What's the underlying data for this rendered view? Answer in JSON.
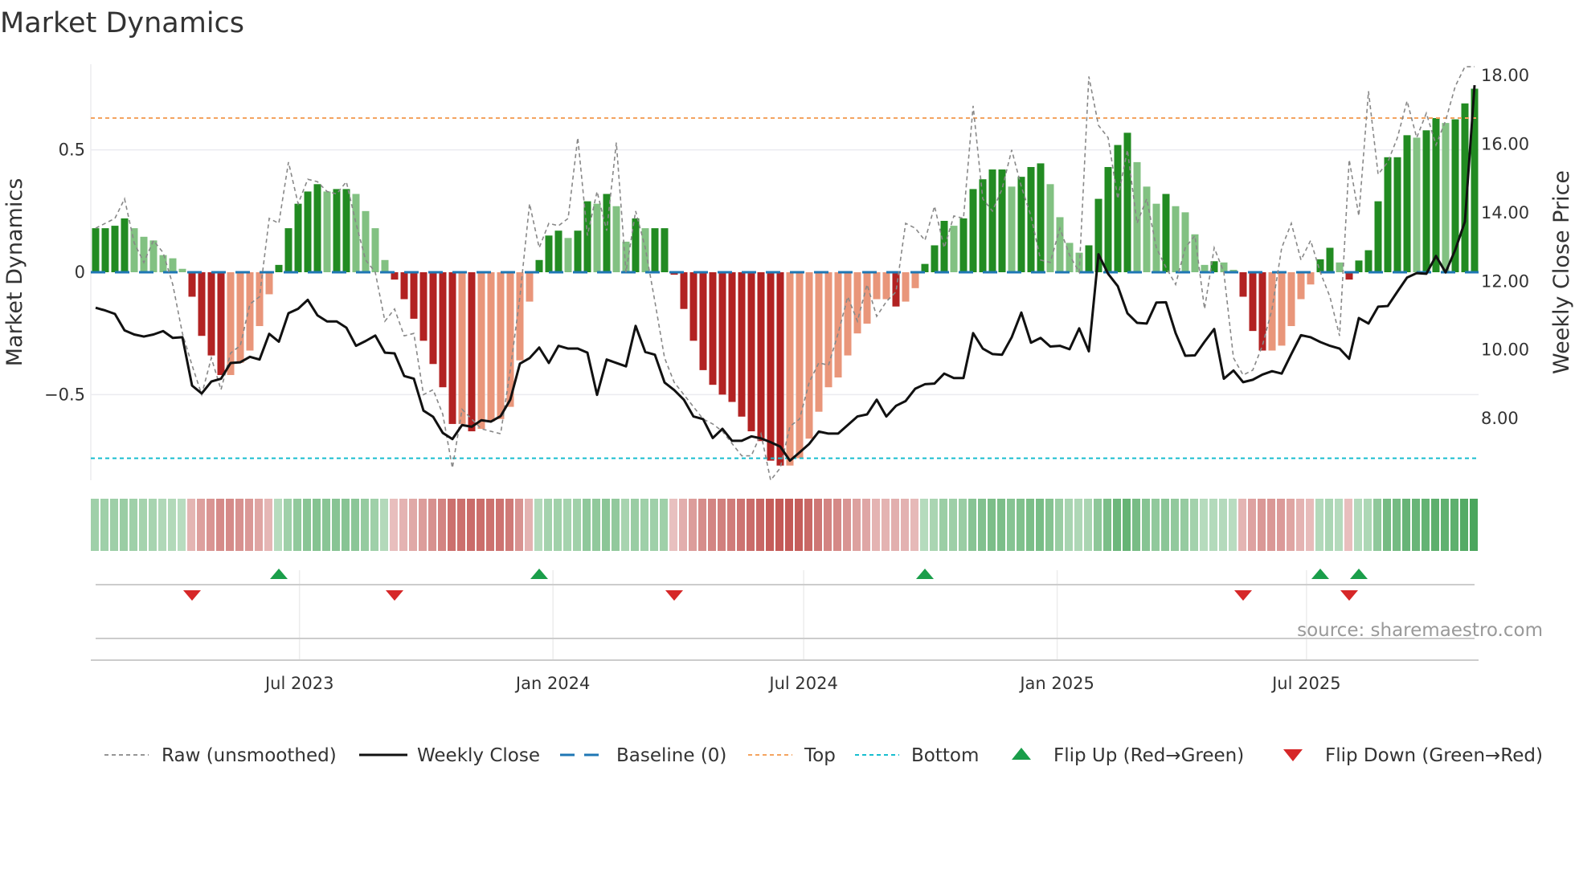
{
  "chart_data": {
    "type": "bar",
    "title": "Market Dynamics",
    "ylabel_left": "Market Dynamics",
    "ylabel_right": "Weekly Close Price",
    "ylim_left": [
      -0.85,
      0.85
    ],
    "ylim_right": [
      6.2,
      18.33
    ],
    "left_ticks": [
      {
        "v": 0.5,
        "label": "0.5"
      },
      {
        "v": 0,
        "label": "0"
      },
      {
        "v": -0.5,
        "label": "−0.5"
      }
    ],
    "right_ticks": [
      {
        "v": 18,
        "label": "18.00"
      },
      {
        "v": 16,
        "label": "16.00"
      },
      {
        "v": 14,
        "label": "14.00"
      },
      {
        "v": 12,
        "label": "12.00"
      },
      {
        "v": 10,
        "label": "10.00"
      },
      {
        "v": 8,
        "label": "8.00"
      }
    ],
    "x_start_date": "2023-02-03",
    "x_frequency": "weekly",
    "x_ticks": [
      {
        "date": "2023-07-01",
        "label": "Jul 2023"
      },
      {
        "date": "2024-01-01",
        "label": "Jan 2024"
      },
      {
        "date": "2024-07-01",
        "label": "Jul 2024"
      },
      {
        "date": "2025-01-01",
        "label": "Jan 2025"
      },
      {
        "date": "2025-07-01",
        "label": "Jul 2025"
      }
    ],
    "top_level": 0.63,
    "bottom_level": -0.76,
    "baseline": 0,
    "series": [
      {
        "name": "Market Dynamics (smoothed)",
        "type": "bar",
        "values": [
          0.18,
          0.18,
          0.19,
          0.22,
          0.18,
          0.145,
          0.13,
          0.07,
          0.057,
          0.014,
          -0.1,
          -0.26,
          -0.34,
          -0.42,
          -0.42,
          -0.37,
          -0.32,
          -0.22,
          -0.09,
          0.03,
          0.18,
          0.28,
          0.33,
          0.36,
          0.33,
          0.34,
          0.34,
          0.32,
          0.25,
          0.18,
          0.05,
          -0.03,
          -0.11,
          -0.19,
          -0.28,
          -0.375,
          -0.47,
          -0.62,
          -0.62,
          -0.65,
          -0.64,
          -0.61,
          -0.6,
          -0.55,
          -0.36,
          -0.12,
          0.05,
          0.15,
          0.17,
          0.14,
          0.17,
          0.29,
          0.28,
          0.32,
          0.27,
          0.125,
          0.22,
          0.18,
          0.18,
          0.18,
          -0.01,
          -0.15,
          -0.28,
          -0.4,
          -0.46,
          -0.5,
          -0.53,
          -0.59,
          -0.65,
          -0.69,
          -0.77,
          -0.79,
          -0.79,
          -0.76,
          -0.68,
          -0.57,
          -0.47,
          -0.43,
          -0.34,
          -0.25,
          -0.21,
          -0.11,
          -0.11,
          -0.14,
          -0.12,
          -0.065,
          0.034,
          0.11,
          0.21,
          0.19,
          0.22,
          0.34,
          0.38,
          0.42,
          0.42,
          0.35,
          0.39,
          0.43,
          0.445,
          0.36,
          0.225,
          0.12,
          0.08,
          0.11,
          0.3,
          0.43,
          0.52,
          0.57,
          0.45,
          0.35,
          0.28,
          0.32,
          0.27,
          0.245,
          0.155,
          0.03,
          0.045,
          0.04,
          0.01,
          -0.1,
          -0.24,
          -0.32,
          -0.32,
          -0.3,
          -0.22,
          -0.11,
          -0.05,
          0.053,
          0.1,
          0.04,
          -0.03,
          0.048,
          0.09,
          0.29,
          0.47,
          0.47,
          0.56,
          0.55,
          0.58,
          0.63,
          0.61,
          0.625,
          0.69,
          0.75
        ]
      },
      {
        "name": "Raw (unsmoothed)",
        "type": "line",
        "values": [
          0.18,
          0.2,
          0.22,
          0.3,
          0.12,
          0.04,
          0.13,
          0.08,
          -0.05,
          -0.25,
          -0.38,
          -0.5,
          -0.35,
          -0.48,
          -0.33,
          -0.3,
          -0.13,
          -0.1,
          0.22,
          0.2,
          0.45,
          0.28,
          0.38,
          0.37,
          0.33,
          0.32,
          0.37,
          0.2,
          0.05,
          0.0,
          -0.2,
          -0.15,
          -0.26,
          -0.25,
          -0.5,
          -0.48,
          -0.58,
          -0.8,
          -0.56,
          -0.6,
          -0.64,
          -0.65,
          -0.66,
          -0.4,
          -0.1,
          0.28,
          0.1,
          0.2,
          0.19,
          0.22,
          0.55,
          0.15,
          0.33,
          0.17,
          0.53,
          0.0,
          0.25,
          0.1,
          -0.12,
          -0.35,
          -0.45,
          -0.5,
          -0.55,
          -0.6,
          -0.62,
          -0.65,
          -0.7,
          -0.75,
          -0.75,
          -0.66,
          -0.85,
          -0.8,
          -0.63,
          -0.6,
          -0.45,
          -0.37,
          -0.38,
          -0.25,
          -0.1,
          -0.2,
          -0.05,
          -0.18,
          -0.12,
          -0.08,
          0.2,
          0.18,
          0.13,
          0.27,
          0.1,
          0.23,
          0.22,
          0.68,
          0.3,
          0.25,
          0.34,
          0.5,
          0.35,
          0.23,
          0.05,
          0.04,
          0.18,
          0.07,
          0.0,
          0.8,
          0.6,
          0.55,
          0.3,
          0.5,
          0.2,
          0.3,
          0.1,
          0.02,
          -0.05,
          0.1,
          0.15,
          -0.15,
          0.1,
          0.0,
          -0.35,
          -0.42,
          -0.4,
          -0.3,
          -0.15,
          0.1,
          0.2,
          0.05,
          0.13,
          0.0,
          -0.1,
          -0.26,
          0.46,
          0.23,
          0.74,
          0.4,
          0.45,
          0.55,
          0.7,
          0.55,
          0.65,
          0.52,
          0.62,
          0.76,
          0.84,
          0.84
        ]
      },
      {
        "name": "Weekly Close",
        "type": "line",
        "axis": "right",
        "values": [
          11.23,
          11.15,
          11.05,
          10.57,
          10.45,
          10.39,
          10.45,
          10.55,
          10.35,
          10.37,
          8.96,
          8.73,
          9.08,
          9.16,
          9.62,
          9.64,
          9.8,
          9.72,
          10.47,
          10.24,
          11.07,
          11.2,
          11.46,
          11.01,
          10.83,
          10.83,
          10.65,
          10.12,
          10.26,
          10.42,
          9.92,
          9.9,
          9.24,
          9.16,
          8.23,
          8.05,
          7.58,
          7.4,
          7.81,
          7.76,
          7.95,
          7.91,
          8.07,
          8.55,
          9.6,
          9.76,
          10.07,
          9.62,
          10.12,
          10.04,
          10.04,
          9.92,
          8.69,
          9.72,
          9.62,
          9.52,
          10.7,
          9.94,
          9.86,
          9.05,
          8.83,
          8.55,
          8.06,
          7.98,
          7.43,
          7.7,
          7.35,
          7.35,
          7.48,
          7.42,
          7.31,
          7.18,
          6.77,
          7.01,
          7.26,
          7.62,
          7.56,
          7.56,
          7.81,
          8.06,
          8.12,
          8.55,
          8.06,
          8.37,
          8.51,
          8.87,
          9.0,
          9.02,
          9.31,
          9.18,
          9.18,
          10.49,
          10.04,
          9.88,
          9.86,
          10.37,
          11.09,
          10.21,
          10.35,
          10.1,
          10.12,
          10.02,
          10.63,
          9.96,
          12.79,
          12.22,
          11.86,
          11.07,
          10.79,
          10.77,
          11.38,
          11.39,
          10.49,
          9.83,
          9.84,
          10.24,
          10.61,
          9.16,
          9.4,
          9.06,
          9.13,
          9.28,
          9.38,
          9.31,
          9.88,
          10.43,
          10.37,
          10.23,
          10.12,
          10.04,
          9.74,
          10.93,
          10.77,
          11.26,
          11.28,
          11.7,
          12.11,
          12.24,
          12.22,
          12.74,
          12.26,
          12.92,
          13.74,
          17.72
        ]
      }
    ],
    "flip_up_weeks": [
      19,
      46,
      86,
      127,
      131
    ],
    "flip_down_weeks": [
      10,
      31,
      60,
      119,
      130
    ],
    "colors": {
      "pos_rising": "#228b22",
      "pos_falling": "#82c182",
      "neg_falling": "#b22222",
      "neg_rising": "#e9967a",
      "close": "#111111",
      "raw": "#888888",
      "baseline": "#1f77b4",
      "top": "#f4a460",
      "bottom": "#17becf",
      "flip_up": "#1a9e4a",
      "flip_down": "#d62728",
      "heat_pos": "#3a9e4e",
      "heat_neg": "#c0504d"
    },
    "legend": [
      {
        "key": "raw",
        "label": "Raw (unsmoothed)"
      },
      {
        "key": "close",
        "label": "Weekly Close"
      },
      {
        "key": "baseline",
        "label": "Baseline (0)"
      },
      {
        "key": "top",
        "label": "Top"
      },
      {
        "key": "bottom",
        "label": "Bottom"
      },
      {
        "key": "flip_up",
        "label": "Flip Up (Red→Green)"
      },
      {
        "key": "flip_down",
        "label": "Flip Down (Green→Red)"
      }
    ],
    "source": "source: sharemaestro.com"
  }
}
